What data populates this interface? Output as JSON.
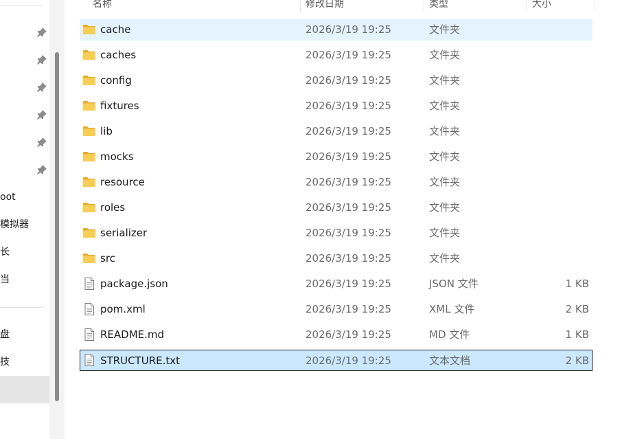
{
  "columns": {
    "name": "名称",
    "date": "修改日期",
    "type": "类型",
    "size": "大小"
  },
  "nav": {
    "items": [
      "oot",
      "模拟器",
      "长",
      "当",
      "盘",
      "技"
    ]
  },
  "files": [
    {
      "name": "cache",
      "date": "2026/3/19 19:25",
      "type": "文件夹",
      "size": "",
      "kind": "folder",
      "state": "hover"
    },
    {
      "name": "caches",
      "date": "2026/3/19 19:25",
      "type": "文件夹",
      "size": "",
      "kind": "folder",
      "state": ""
    },
    {
      "name": "config",
      "date": "2026/3/19 19:25",
      "type": "文件夹",
      "size": "",
      "kind": "folder",
      "state": ""
    },
    {
      "name": "fixtures",
      "date": "2026/3/19 19:25",
      "type": "文件夹",
      "size": "",
      "kind": "folder",
      "state": ""
    },
    {
      "name": "lib",
      "date": "2026/3/19 19:25",
      "type": "文件夹",
      "size": "",
      "kind": "folder",
      "state": ""
    },
    {
      "name": "mocks",
      "date": "2026/3/19 19:25",
      "type": "文件夹",
      "size": "",
      "kind": "folder",
      "state": ""
    },
    {
      "name": "resource",
      "date": "2026/3/19 19:25",
      "type": "文件夹",
      "size": "",
      "kind": "folder",
      "state": ""
    },
    {
      "name": "roles",
      "date": "2026/3/19 19:25",
      "type": "文件夹",
      "size": "",
      "kind": "folder",
      "state": ""
    },
    {
      "name": "serializer",
      "date": "2026/3/19 19:25",
      "type": "文件夹",
      "size": "",
      "kind": "folder",
      "state": ""
    },
    {
      "name": "src",
      "date": "2026/3/19 19:25",
      "type": "文件夹",
      "size": "",
      "kind": "folder",
      "state": ""
    },
    {
      "name": "package.json",
      "date": "2026/3/19 19:25",
      "type": "JSON 文件",
      "size": "1 KB",
      "kind": "file",
      "state": ""
    },
    {
      "name": "pom.xml",
      "date": "2026/3/19 19:25",
      "type": "XML 文件",
      "size": "2 KB",
      "kind": "file",
      "state": ""
    },
    {
      "name": "README.md",
      "date": "2026/3/19 19:25",
      "type": "MD 文件",
      "size": "1 KB",
      "kind": "file",
      "state": ""
    },
    {
      "name": "STRUCTURE.txt",
      "date": "2026/3/19 19:25",
      "type": "文本文档",
      "size": "2 KB",
      "kind": "file",
      "state": "selected"
    }
  ],
  "icons": {
    "folder": "folder-icon",
    "file": "document-icon",
    "pin": "pin-icon"
  },
  "colors": {
    "hover": "#e5f3ff",
    "selected": "#cce8ff",
    "folder": "#f4c246"
  }
}
